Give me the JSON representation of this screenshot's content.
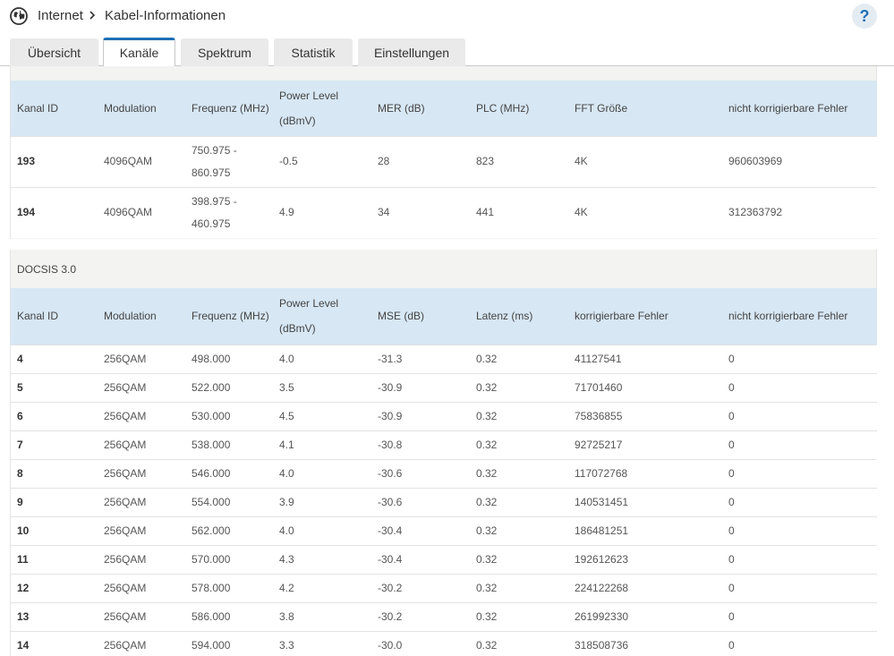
{
  "header": {
    "breadcrumb_root": "Internet",
    "breadcrumb_page": "Kabel-Informationen",
    "help_label": "?"
  },
  "tabs": [
    {
      "label": "Übersicht",
      "active": false
    },
    {
      "label": "Kanäle",
      "active": true
    },
    {
      "label": "Spektrum",
      "active": false
    },
    {
      "label": "Statistik",
      "active": false
    },
    {
      "label": "Einstellungen",
      "active": false
    }
  ],
  "docsis31": {
    "headers": [
      "Kanal ID",
      "Modulation",
      "Frequenz (MHz)",
      "Power Level (dBmV)",
      "MER (dB)",
      "PLC (MHz)",
      "FFT Größe",
      "nicht korrigierbare Fehler"
    ],
    "rows": [
      {
        "id": "193",
        "modulation": "4096QAM",
        "freq": "750.975 - 860.975",
        "power": "-0.5",
        "mer": "28",
        "plc": "823",
        "fft": "4K",
        "uncorrectable": "960603969"
      },
      {
        "id": "194",
        "modulation": "4096QAM",
        "freq": "398.975 - 460.975",
        "power": "4.9",
        "mer": "34",
        "plc": "441",
        "fft": "4K",
        "uncorrectable": "312363792"
      }
    ]
  },
  "docsis30": {
    "label": "DOCSIS 3.0",
    "headers": [
      "Kanal ID",
      "Modulation",
      "Frequenz (MHz)",
      "Power Level (dBmV)",
      "MSE (dB)",
      "Latenz (ms)",
      "korrigierbare Fehler",
      "nicht korrigierbare Fehler"
    ],
    "rows": [
      {
        "id": "4",
        "modulation": "256QAM",
        "freq": "498.000",
        "power": "4.0",
        "mse": "-31.3",
        "latency": "0.32",
        "correctable": "41127541",
        "uncorrectable": "0"
      },
      {
        "id": "5",
        "modulation": "256QAM",
        "freq": "522.000",
        "power": "3.5",
        "mse": "-30.9",
        "latency": "0.32",
        "correctable": "71701460",
        "uncorrectable": "0"
      },
      {
        "id": "6",
        "modulation": "256QAM",
        "freq": "530.000",
        "power": "4.5",
        "mse": "-30.9",
        "latency": "0.32",
        "correctable": "75836855",
        "uncorrectable": "0"
      },
      {
        "id": "7",
        "modulation": "256QAM",
        "freq": "538.000",
        "power": "4.1",
        "mse": "-30.8",
        "latency": "0.32",
        "correctable": "92725217",
        "uncorrectable": "0"
      },
      {
        "id": "8",
        "modulation": "256QAM",
        "freq": "546.000",
        "power": "4.0",
        "mse": "-30.6",
        "latency": "0.32",
        "correctable": "117072768",
        "uncorrectable": "0"
      },
      {
        "id": "9",
        "modulation": "256QAM",
        "freq": "554.000",
        "power": "3.9",
        "mse": "-30.6",
        "latency": "0.32",
        "correctable": "140531451",
        "uncorrectable": "0"
      },
      {
        "id": "10",
        "modulation": "256QAM",
        "freq": "562.000",
        "power": "4.0",
        "mse": "-30.4",
        "latency": "0.32",
        "correctable": "186481251",
        "uncorrectable": "0"
      },
      {
        "id": "11",
        "modulation": "256QAM",
        "freq": "570.000",
        "power": "4.3",
        "mse": "-30.4",
        "latency": "0.32",
        "correctable": "192612623",
        "uncorrectable": "0"
      },
      {
        "id": "12",
        "modulation": "256QAM",
        "freq": "578.000",
        "power": "4.2",
        "mse": "-30.2",
        "latency": "0.32",
        "correctable": "224122268",
        "uncorrectable": "0"
      },
      {
        "id": "13",
        "modulation": "256QAM",
        "freq": "586.000",
        "power": "3.8",
        "mse": "-30.2",
        "latency": "0.32",
        "correctable": "261992330",
        "uncorrectable": "0"
      },
      {
        "id": "14",
        "modulation": "256QAM",
        "freq": "594.000",
        "power": "3.3",
        "mse": "-30.0",
        "latency": "0.32",
        "correctable": "318508736",
        "uncorrectable": "0"
      }
    ]
  },
  "colors": {
    "accent": "#1f6fb5",
    "header_row": "#d7e7f4",
    "panel_bg": "#f3f3f1",
    "tab_bg": "#eaeaea"
  },
  "icons": {
    "globe": "globe-icon",
    "breadcrumb_separator": "chevron-right-icon",
    "help": "help-icon"
  }
}
